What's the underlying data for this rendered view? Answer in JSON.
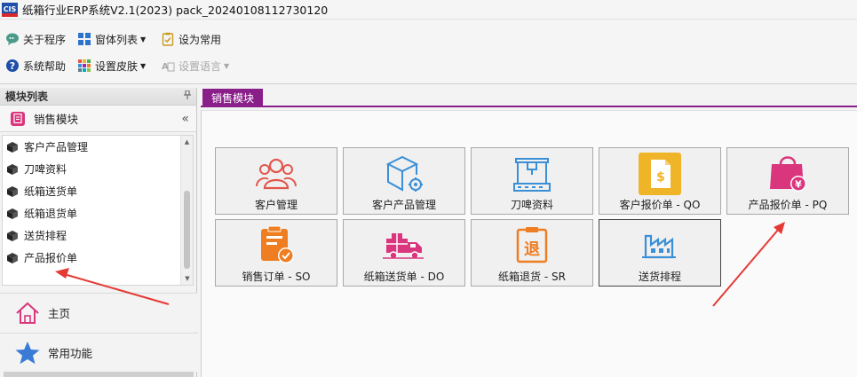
{
  "window": {
    "title": "纸箱行业ERP系统V2.1(2023) pack_20240108112730120",
    "icon_text": "CIS"
  },
  "toolbar": {
    "about": "关于程序",
    "window_list": "窗体列表",
    "set_common": "设为常用",
    "help": "系统帮助",
    "skin": "设置皮肤",
    "language": "设置语言"
  },
  "left_panel": {
    "header": "模块列表",
    "pin": "ᵖ",
    "group": "销售模块",
    "collapse": "«",
    "items": [
      "客户产品管理",
      "刀啤资料",
      "纸箱送货单",
      "纸箱退货单",
      "送货排程",
      "产品报价单"
    ],
    "nav": [
      "主页",
      "常用功能"
    ]
  },
  "main": {
    "tab": "销售模块",
    "tiles": [
      {
        "label": "客户管理",
        "icon": "customers-icon"
      },
      {
        "label": "客户产品管理",
        "icon": "product-box-icon"
      },
      {
        "label": "刀啤资料",
        "icon": "cutting-die-icon"
      },
      {
        "label": "客户报价单 - QO",
        "icon": "quote-document-icon"
      },
      {
        "label": "产品报价单 - PQ",
        "icon": "price-bag-icon"
      },
      {
        "label": "销售订单 - SO",
        "icon": "sales-order-icon"
      },
      {
        "label": "纸箱送货单 - DO",
        "icon": "delivery-truck-icon"
      },
      {
        "label": "纸箱退货 - SR",
        "icon": "return-icon"
      },
      {
        "label": "送货排程",
        "icon": "factory-schedule-icon"
      }
    ],
    "tile_icon_glyphs": {
      "return": "退",
      "price": "¥",
      "dollar": "$"
    }
  },
  "colors": {
    "accent_purple": "#8a1f8a",
    "icon_red": "#e2574c",
    "icon_orange": "#ef7d22",
    "icon_blue": "#3a8fd6",
    "icon_yellow": "#f0b429",
    "icon_pink": "#d9367d",
    "arrow_red": "#e53935"
  }
}
